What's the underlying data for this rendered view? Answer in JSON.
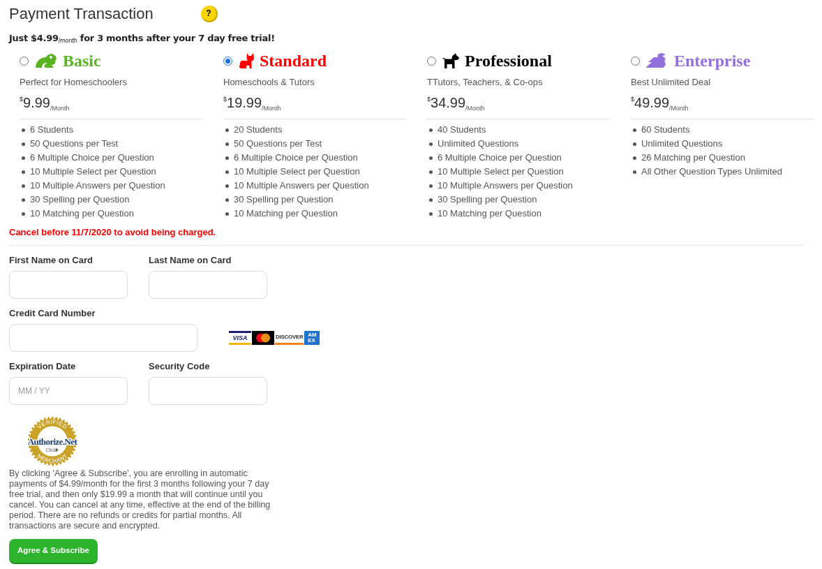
{
  "page": {
    "title": "Payment Transaction",
    "help": "?"
  },
  "promo": "Just $4.99$_{/month}$ for 3 months after your 7 day free trial!",
  "plans": [
    {
      "name": "Basic",
      "kind": "frog",
      "color": "#5ab422",
      "selected": false,
      "description": "Perfect for Homeschoolers",
      "currency": "$",
      "price": "9.99",
      "period": "/Month",
      "features": [
        "6 Students",
        "50 Questions per Test",
        "6 Multiple Choice per Question",
        "10 Multiple Select per Question",
        "10 Multiple Answers per Question",
        "30 Spelling per Question",
        "10 Matching per Question"
      ]
    },
    {
      "name": "Standard",
      "kind": "cat",
      "color": "#ff0000",
      "selected": true,
      "description": "Homeschools & Tutors",
      "currency": "$",
      "price": "19.99",
      "period": "/Month",
      "features": [
        "20 Students",
        "50 Questions per Test",
        "6 Multiple Choice per Question",
        "10 Multiple Select per Question",
        "10 Multiple Answers per Question",
        "30 Spelling per Question",
        "10 Matching per Question"
      ]
    },
    {
      "name": "Professional",
      "kind": "dog",
      "color": "#000000",
      "selected": false,
      "description": "TTutors, Teachers, & Co-ops",
      "currency": "$",
      "price": "34.99",
      "period": "/Month",
      "features": [
        "40 Students",
        "Unlimited Questions",
        "6 Multiple Choice per Question",
        "10 Multiple Select per Question",
        "10 Multiple Answers per Question",
        "30 Spelling per Question",
        "10 Matching per Question"
      ]
    },
    {
      "name": "Enterprise",
      "kind": "dragon",
      "color": "#9370db",
      "selected": false,
      "description": "Best Unlimited Deal",
      "currency": "$",
      "price": "49.99",
      "period": "/Month",
      "features": [
        "60 Students",
        "Unlimited Questions",
        "26 Matching per Question",
        "All Other Question Types Unlimited"
      ]
    }
  ],
  "notice": "Cancel before 11/7/2020 to avoid being charged.",
  "form": {
    "first_name": {
      "label": "First Name on Card"
    },
    "last_name": {
      "label": "Last Name on Card"
    },
    "card_number": {
      "label": "Credit Card Number"
    },
    "card_brands": [
      {
        "kind": "visa",
        "label": "VISA"
      },
      {
        "kind": "mastercard"
      },
      {
        "kind": "discover",
        "label": "DISCOVER"
      },
      {
        "kind": "amex",
        "lines": [
          "AM",
          "EX"
        ]
      }
    ],
    "expiration": {
      "label": "Expiration Date",
      "placeholder": "MM / YY"
    },
    "security_code": {
      "label": "Security Code"
    }
  },
  "seal": {
    "top": "VERIFIED",
    "name": "Authorize.Net",
    "action": "Click",
    "bottom": "MERCHANT"
  },
  "disclaimer": "By clicking 'Agree & Subscribe', you are enrolling in automatic payments of $4.99/month for the first 3 months following your 7 day free trial, and then only $19.99 a month that will continue until you cancel. You can cancel at any time, effective at the end of the billing period. There are no refunds or credits for partial months. All transactions are secure and encrypted.",
  "submit": {
    "label": "Agree & Subscribe"
  }
}
